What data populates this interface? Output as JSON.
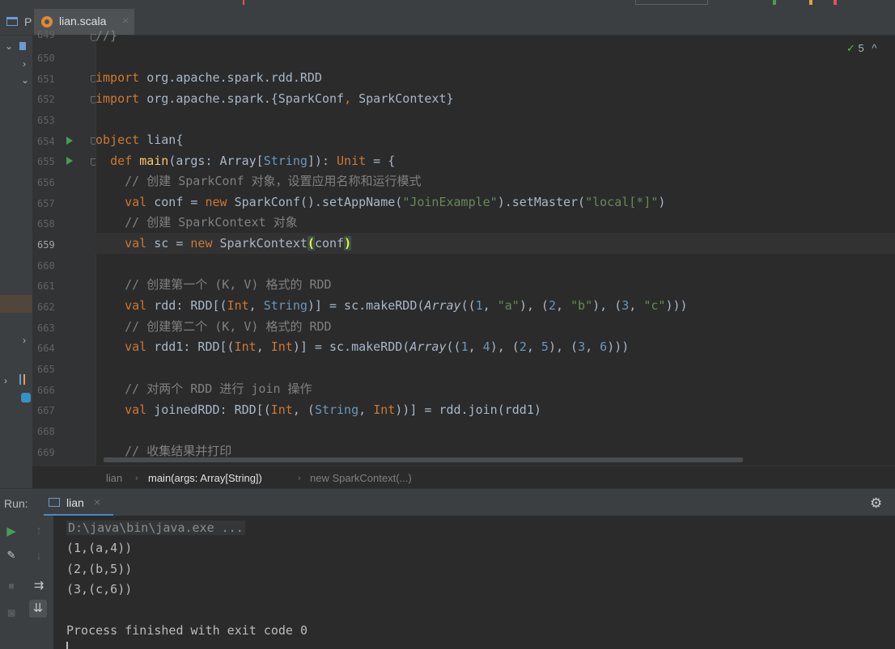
{
  "editor": {
    "project_tab_label": "P",
    "tab_label": "lian.scala",
    "tab_close": "×",
    "inspection_count": "5",
    "inspection_arrow": "^",
    "line_numbers": [
      "649",
      "650",
      "651",
      "652",
      "653",
      "654",
      "655",
      "656",
      "657",
      "658",
      "659",
      "660",
      "661",
      "662",
      "663",
      "664",
      "665",
      "666",
      "667",
      "668",
      "669"
    ],
    "code": {
      "l649": "//}",
      "l651_kw": "import",
      "l651_rest": " org.apache.spark.rdd.RDD",
      "l652_kw": "import",
      "l652_a": " org.apache.spark.{SparkConf",
      "l652_comma": ",",
      "l652_b": " SparkContext}",
      "l654_kw": "object",
      "l654_rest": " lian{",
      "l655_def": "def",
      "l655_name": "main",
      "l655_a": "(args: Array[",
      "l655_string": "String",
      "l655_b": "]): ",
      "l655_unit": "Unit",
      "l655_c": " = {",
      "l656": "// 创建 SparkConf 对象，设置应用名称和运行模式",
      "l657_val": "val",
      "l657_a": " conf = ",
      "l657_new": "new",
      "l657_b": " SparkConf().setAppName(",
      "l657_s1": "\"JoinExample\"",
      "l657_c": ").setMaster(",
      "l657_s2": "\"local[*]\"",
      "l657_d": ")",
      "l658": "// 创建 SparkContext 对象",
      "l659_val": "val",
      "l659_a": " sc = ",
      "l659_new": "new",
      "l659_b": " SparkContext",
      "l659_open": "(",
      "l659_c": "conf",
      "l659_close": ")",
      "l661": "// 创建第一个 (K, V) 格式的 RDD",
      "l662_val": "val",
      "l662_a": " rdd: RDD[(",
      "l662_int": "Int",
      "l662_b": ", ",
      "l662_string": "String",
      "l662_c": ")] = sc.makeRDD(",
      "l662_arr": "Array",
      "l662_d": "((",
      "l662_n1": "1",
      "l662_e": ", ",
      "l662_s1": "\"a\"",
      "l662_f": "), (",
      "l662_n2": "2",
      "l662_g": ", ",
      "l662_s2": "\"b\"",
      "l662_h": "), (",
      "l662_n3": "3",
      "l662_i": ", ",
      "l662_s3": "\"c\"",
      "l662_j": ")))",
      "l663": "// 创建第二个 (K, V) 格式的 RDD",
      "l664_val": "val",
      "l664_a": " rdd1: RDD[(",
      "l664_int1": "Int",
      "l664_b": ", ",
      "l664_int2": "Int",
      "l664_c": ")] = sc.makeRDD(",
      "l664_arr": "Array",
      "l664_d": "((",
      "l664_n1": "1",
      "l664_e": ", ",
      "l664_n2": "4",
      "l664_f": "), (",
      "l664_n3": "2",
      "l664_g": ", ",
      "l664_n4": "5",
      "l664_h": "), (",
      "l664_n5": "3",
      "l664_i": ", ",
      "l664_n6": "6",
      "l664_j": ")))",
      "l666": "// 对两个 RDD 进行 join 操作",
      "l667_val": "val",
      "l667_a": " joinedRDD: RDD[(",
      "l667_int1": "Int",
      "l667_b": ", (",
      "l667_string": "String",
      "l667_c": ", ",
      "l667_int2": "Int",
      "l667_d": "))] = rdd.join(rdd1)",
      "l669": "// 收集结果并打印"
    }
  },
  "breadcrumb": {
    "items": [
      "lian",
      "main(args: Array[String])",
      "new SparkContext(...)"
    ],
    "sep": "›"
  },
  "run": {
    "label": "Run:",
    "tab_label": "lian",
    "tab_close": "×",
    "output": [
      "D:\\java\\bin\\java.exe ...",
      "(1,(a,4))",
      "(2,(b,5))",
      "(3,(c,6))",
      "",
      "Process finished with exit code 0"
    ]
  },
  "icons": {
    "gear": "⚙",
    "run": "▶",
    "up": "↑",
    "down": "↓",
    "wrench": "🔧",
    "stop": "■",
    "camera": "◙",
    "wrap": "⇉",
    "scroll_end": "⇊"
  },
  "colors": {
    "keyword": "#cc7832",
    "function": "#ffc66d",
    "string": "#6a8759",
    "number": "#6897bb",
    "comment": "#808080",
    "background": "#2b2b2b",
    "accent": "#4a88c7"
  }
}
